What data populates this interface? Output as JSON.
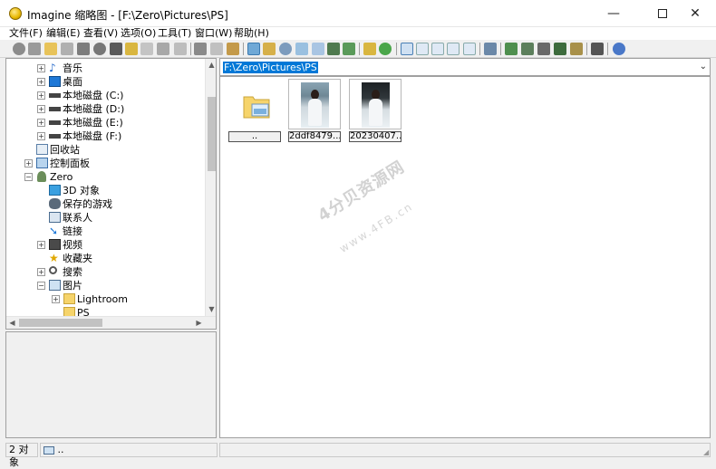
{
  "window": {
    "app_name": "Imagine 缩略图",
    "title": "Imagine 缩略图 - [F:\\Zero\\Pictures\\PS]",
    "min": "—",
    "close": "✕"
  },
  "menu": [
    "文件(F)",
    "编辑(E)",
    "查看(V)",
    "选项(O)",
    "工具(T)",
    "窗口(W)",
    "帮助(H)"
  ],
  "tree": [
    {
      "label": "音乐",
      "icon": "music-icon",
      "level": 2,
      "expander": "+"
    },
    {
      "label": "桌面",
      "icon": "desktop-icon",
      "level": 2,
      "expander": "+"
    },
    {
      "label": "本地磁盘 (C:)",
      "icon": "drive-icon",
      "level": 2,
      "expander": "+"
    },
    {
      "label": "本地磁盘 (D:)",
      "icon": "drive-icon",
      "level": 2,
      "expander": "+"
    },
    {
      "label": "本地磁盘 (E:)",
      "icon": "drive-icon",
      "level": 2,
      "expander": "+"
    },
    {
      "label": "本地磁盘 (F:)",
      "icon": "drive-icon",
      "level": 2,
      "expander": "+"
    },
    {
      "label": "回收站",
      "icon": "recycle-bin-icon",
      "level": 1,
      "expander": ""
    },
    {
      "label": "控制面板",
      "icon": "control-panel-icon",
      "level": 1,
      "expander": "+"
    },
    {
      "label": "Zero",
      "icon": "user-icon",
      "level": 1,
      "expander": "−"
    },
    {
      "label": "3D 对象",
      "icon": "cube-icon",
      "level": 2,
      "expander": ""
    },
    {
      "label": "保存的游戏",
      "icon": "game-icon",
      "level": 2,
      "expander": ""
    },
    {
      "label": "联系人",
      "icon": "contacts-icon",
      "level": 2,
      "expander": ""
    },
    {
      "label": "链接",
      "icon": "link-icon",
      "level": 2,
      "expander": ""
    },
    {
      "label": "视频",
      "icon": "video-icon",
      "level": 2,
      "expander": "+"
    },
    {
      "label": "收藏夹",
      "icon": "star-icon",
      "level": 2,
      "expander": ""
    },
    {
      "label": "搜索",
      "icon": "search-icon",
      "level": 2,
      "expander": "+"
    },
    {
      "label": "图片",
      "icon": "pictures-icon",
      "level": 2,
      "expander": "−"
    },
    {
      "label": "Lightroom",
      "icon": "folder-icon",
      "level": 3,
      "expander": "+"
    },
    {
      "label": "PS",
      "icon": "folder-icon",
      "level": 3,
      "expander": ""
    }
  ],
  "path": {
    "value": "F:\\Zero\\Pictures\\PS"
  },
  "thumbnails": [
    {
      "label": "..",
      "kind": "parent-folder"
    },
    {
      "label": "2ddf8479...",
      "kind": "photo"
    },
    {
      "label": "20230407...",
      "kind": "photo"
    }
  ],
  "watermark": {
    "logo": "4分贝资源网",
    "url": "www.4FB.cn"
  },
  "status": {
    "count": "2 对象",
    "path": ".."
  },
  "colors": {
    "selection": "#0078d7",
    "folder": "#f6d46b"
  }
}
